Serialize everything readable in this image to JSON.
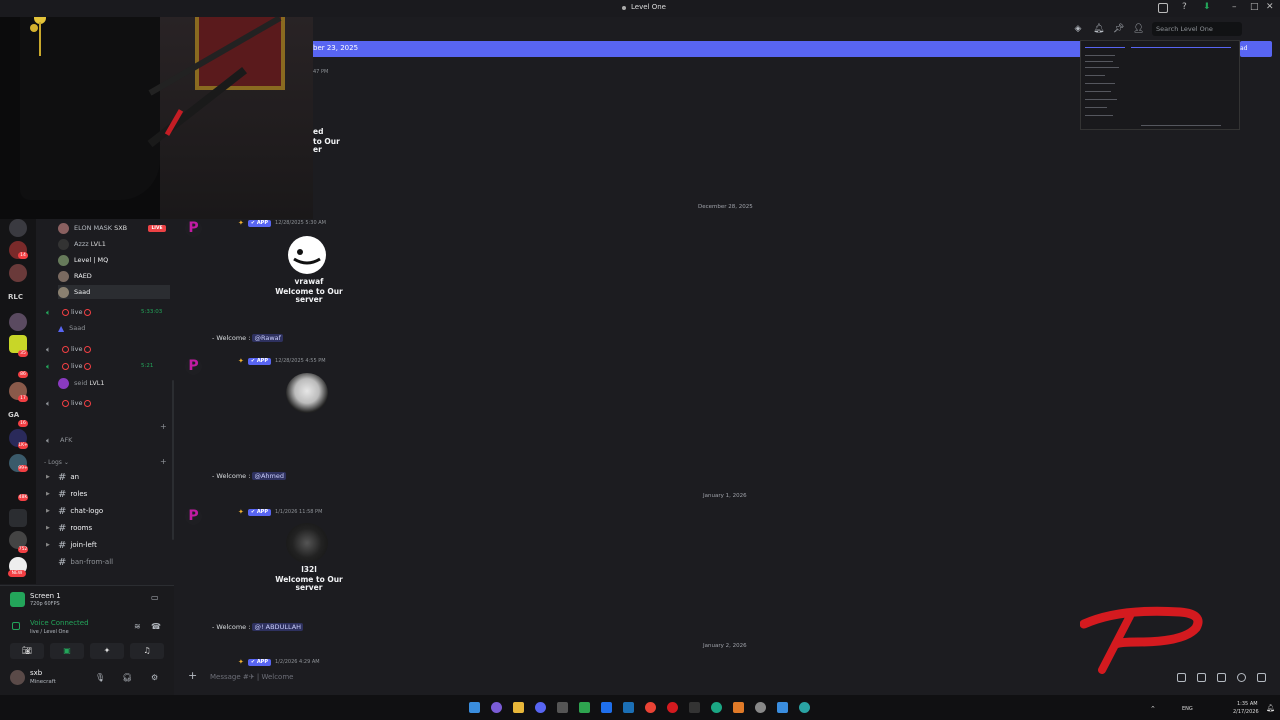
{
  "window": {
    "title": "Level One"
  },
  "header": {
    "search_placeholder": "Search Level One"
  },
  "banner": {
    "text": "ber 23, 2025",
    "right_text": "ad"
  },
  "faded_message": {
    "time": "47 PM",
    "line1": "ed",
    "line2": "to Our",
    "line3": "er"
  },
  "server_rail": {
    "labels": [
      "RLC",
      "GA"
    ],
    "badges": [
      "14",
      "35",
      "86",
      "17",
      "16",
      "1K+",
      "99+",
      "48K",
      "752"
    ],
    "new_badge": "NEW"
  },
  "channels": {
    "voice_users_top": [
      {
        "name": "ELON MASK",
        "tag": "SXB",
        "live": "LIVE"
      },
      {
        "name": "Azzz",
        "tag": "LVL1"
      },
      {
        "name": "Level | MQ"
      },
      {
        "name": "RAED"
      },
      {
        "name": "Saad"
      }
    ],
    "voice_channels": [
      {
        "label": "live",
        "timer": "5:33:03",
        "member": "Saad"
      },
      {
        "label": "live"
      },
      {
        "label": "live",
        "timer": "5:21",
        "member": "seid",
        "member_tag": "LVL1"
      },
      {
        "label": "live"
      }
    ],
    "afk_label": "AFK",
    "logs_category": "Logs",
    "text_channels": [
      "an",
      "roles",
      "chat-logo",
      "rooms",
      "join-left",
      "ban-from-all"
    ]
  },
  "panel": {
    "screen_name": "Screen 1",
    "screen_sub": "720p 60FPS",
    "voice_title": "Voice Connected",
    "voice_sub": "live / Level One"
  },
  "user": {
    "name": "sxb",
    "status": "Minecraft"
  },
  "messages": [
    {
      "date": "December 28, 2025",
      "time": "12/28/2025 5:30 AM",
      "app_label": "APP",
      "card_name": "vrawaf",
      "card_line1": "Welcome to Our",
      "card_line2": "server",
      "welcome_prefix": "- Welcome :",
      "mention": "@Rawaf"
    },
    {
      "time": "12/28/2025 4:55 PM",
      "app_label": "APP",
      "welcome_prefix": "- Welcome :",
      "mention": "@Ahmed"
    },
    {
      "date": "January 1, 2026",
      "time": "1/1/2026 11:58 PM",
      "app_label": "APP",
      "card_name": "l32l",
      "card_line1": "Welcome to Our",
      "card_line2": "server",
      "welcome_prefix": "- Welcome :",
      "mention": "@! ABDULLAH"
    },
    {
      "date": "January 2, 2026",
      "time": "1/2/2026 4:29 AM",
      "app_label": "APP"
    }
  ],
  "composer": {
    "placeholder": "Message #✈ | Welcome"
  },
  "taskbar": {
    "lang": "ENG",
    "time": "1:35 AM",
    "date": "2/17/2026"
  },
  "colors": {
    "accent": "#5865f2",
    "online": "#23a55a",
    "live": "#ed4245",
    "brand_red": "#d41a1f"
  }
}
